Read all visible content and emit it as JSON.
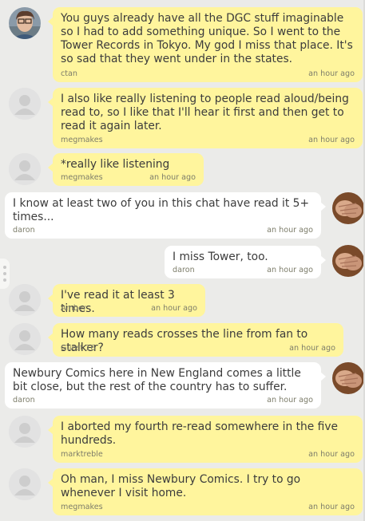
{
  "messages": [
    {
      "user": "ctan",
      "time": "an hour ago",
      "text": "You guys already have all the DGC stuff imaginable so I had to add something unique. So I went to the Tower Records in Tokyo. My god I miss that place. It's so sad that they went under in the states.",
      "avatar": "photo-woman",
      "side": "left"
    },
    {
      "user": "megmakes",
      "time": "an hour ago",
      "text": "I also like really listening to people read aloud/being read to, so I like that I'll hear it first and then get to read it again later.",
      "avatar": "default",
      "side": "left"
    },
    {
      "user": "megmakes",
      "time": "an hour ago",
      "text": "*really like listening",
      "avatar": "default",
      "side": "left"
    },
    {
      "user": "daron",
      "time": "an hour ago",
      "text": "I know at least two of you in this chat have read it 5+ times...",
      "avatar": "photo-hands",
      "side": "right"
    },
    {
      "user": "daron",
      "time": "an hour ago",
      "text": "I miss Tower, too.",
      "avatar": "photo-hands",
      "side": "right"
    },
    {
      "user": "Amber",
      "time": "an hour ago",
      "text": "I've read it at least 3 times.",
      "avatar": "default",
      "side": "left"
    },
    {
      "user": "Guest 16",
      "time": "an hour ago",
      "text": "How many reads crosses the line from fan to stalker?",
      "avatar": "default",
      "side": "left"
    },
    {
      "user": "daron",
      "time": "an hour ago",
      "text": "Newbury Comics here in New England comes a little bit close, but the rest of the country has to suffer.",
      "avatar": "photo-hands",
      "side": "right"
    },
    {
      "user": "marktreble",
      "time": "an hour ago",
      "text": "I aborted my fourth re-read somewhere in the five hundreds.",
      "avatar": "default",
      "side": "left"
    },
    {
      "user": "megmakes",
      "time": "an hour ago",
      "text": "Oh man, I miss Newbury Comics. I try to go whenever I visit home.",
      "avatar": "default",
      "side": "left"
    }
  ],
  "colors": {
    "own_bubble": "#fff59d",
    "other_bubble": "#ffffff",
    "background": "#ebebe9"
  }
}
